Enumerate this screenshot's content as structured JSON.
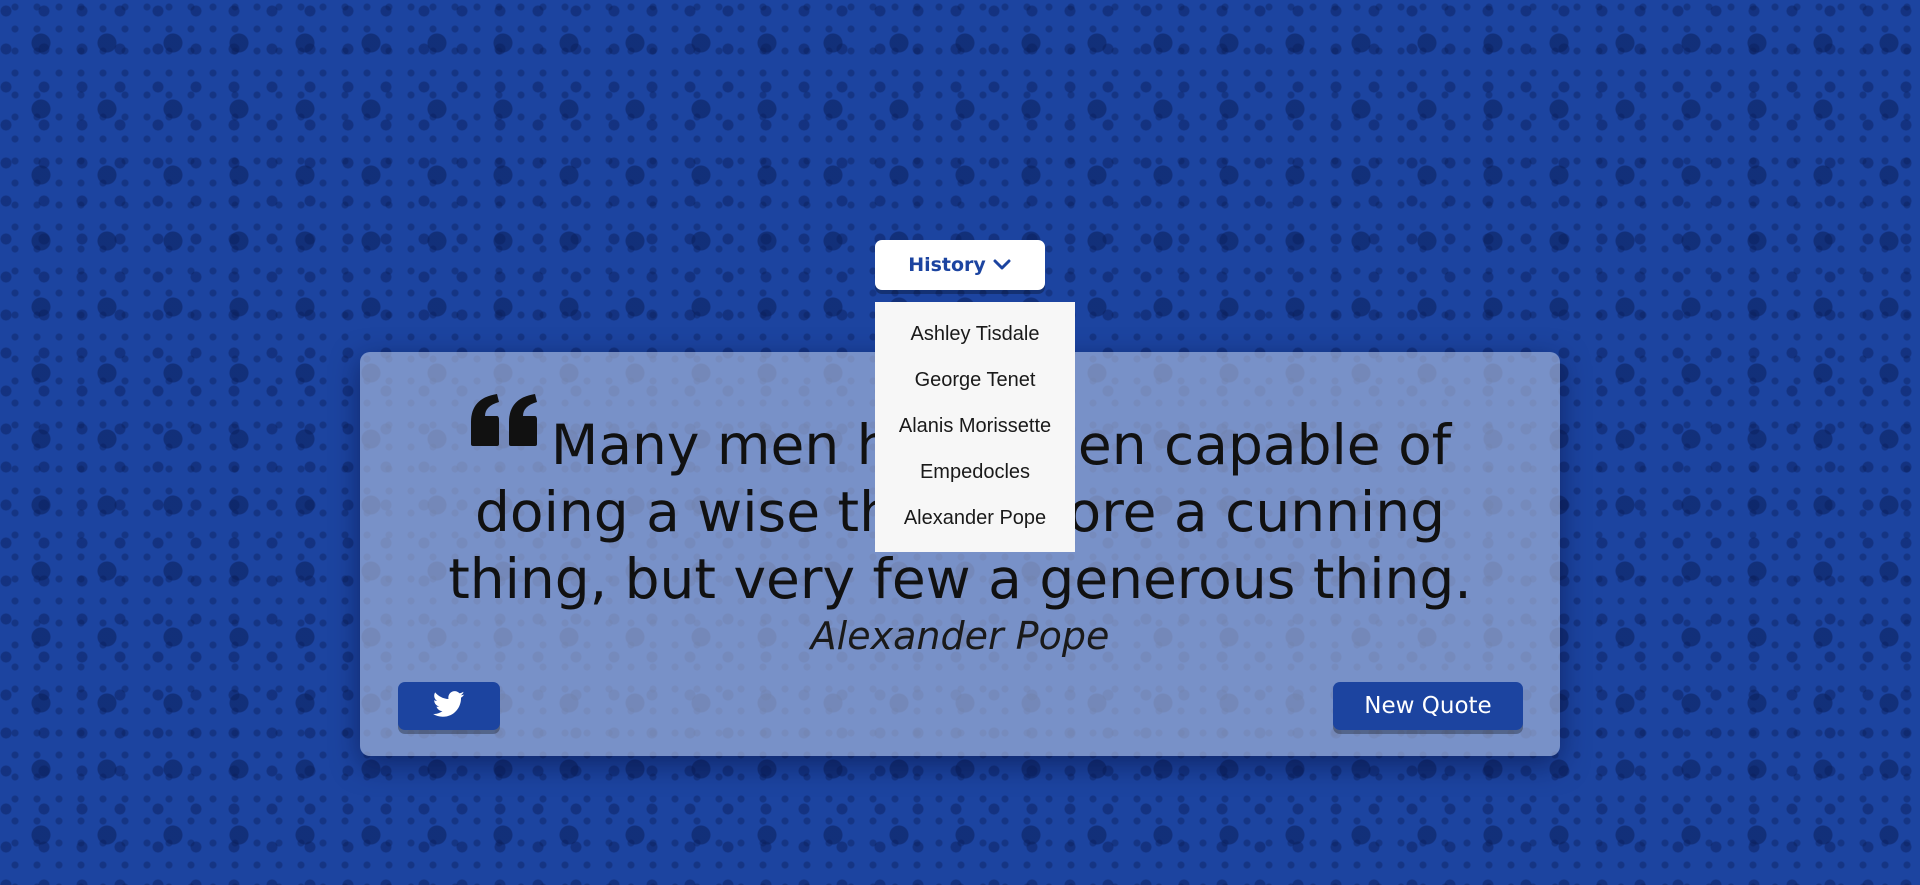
{
  "header": {
    "history_label": "History",
    "history_icon": "chevron-down-icon"
  },
  "history_dropdown": {
    "items": [
      {
        "label": "Ashley Tisdale"
      },
      {
        "label": "George Tenet"
      },
      {
        "label": "Alanis Morissette"
      },
      {
        "label": "Empedocles"
      },
      {
        "label": "Alexander Pope"
      }
    ]
  },
  "quote": {
    "icon": "quote-left-icon",
    "text": "Many men have been capable of doing a wise thing, more a cunning thing, but very few a generous thing.",
    "author": "Alexander Pope"
  },
  "actions": {
    "tweet_icon": "twitter-icon",
    "new_quote_label": "New Quote"
  },
  "colors": {
    "background": "#1c44a0",
    "accent": "#1c44a0",
    "card": "#b2c0e0",
    "dropdown": "#f7f7f7",
    "text": "#111111"
  }
}
